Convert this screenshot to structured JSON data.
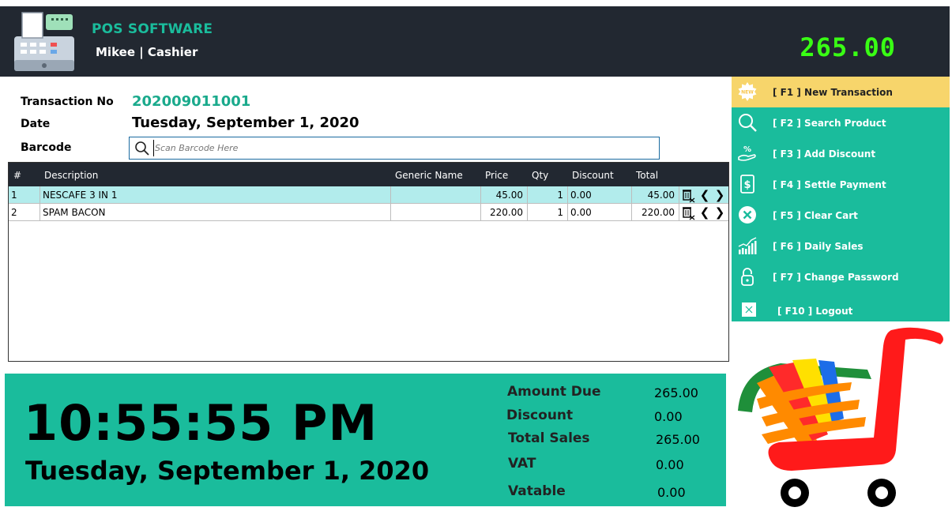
{
  "header": {
    "app_title": "POS SOFTWARE",
    "user_line": "Mikee | Cashier",
    "total": "265.00"
  },
  "form": {
    "transaction_label": "Transaction No",
    "transaction_no": "202009011001",
    "date_label": "Date",
    "date_value": "Tuesday, September 1, 2020",
    "barcode_label": "Barcode",
    "barcode_placeholder": "Scan Barcode Here"
  },
  "table": {
    "columns": [
      "#",
      "Description",
      "Generic Name",
      "Price",
      "Qty",
      "Discount",
      "Total"
    ],
    "rows": [
      {
        "no": "1",
        "description": "NESCAFE 3 IN 1",
        "generic": "",
        "price": "45.00",
        "qty": "1",
        "discount": "0.00",
        "total": "45.00"
      },
      {
        "no": "2",
        "description": "SPAM BACON",
        "generic": "",
        "price": "220.00",
        "qty": "1",
        "discount": "0.00",
        "total": "220.00"
      }
    ]
  },
  "menu": {
    "items": [
      {
        "label": "[ F1 ] New Transaction",
        "icon": "new-badge-icon"
      },
      {
        "label": "[ F2 ] Search Product",
        "icon": "search-icon"
      },
      {
        "label": "[ F3 ] Add Discount",
        "icon": "discount-hand-icon"
      },
      {
        "label": "[ F4 ] Settle Payment",
        "icon": "dollar-icon"
      },
      {
        "label": "[ F5 ] Clear Cart",
        "icon": "close-circle-icon"
      },
      {
        "label": "[ F6 ] Daily Sales",
        "icon": "chart-icon"
      },
      {
        "label": "[ F7 ] Change Password",
        "icon": "lock-icon"
      },
      {
        "label": "[ F10 ] Logout",
        "icon": "logout-icon"
      }
    ]
  },
  "summary": {
    "time": "10:55:55 PM",
    "date": "Tuesday, September 1, 2020",
    "amount_due_label": "Amount Due",
    "amount_due": "265.00",
    "discount_label": "Discount",
    "discount": "0.00",
    "total_sales_label": "Total Sales",
    "total_sales": "265.00",
    "vat_label": "VAT",
    "vat": "0.00",
    "vatable_label": "Vatable",
    "vatable": "0.00"
  },
  "colors": {
    "accent": "#1abc9c",
    "header_bg": "#222831",
    "total_green": "#39ff14",
    "active_menu": "#f7d56b",
    "selected_row": "#b2ecec"
  }
}
